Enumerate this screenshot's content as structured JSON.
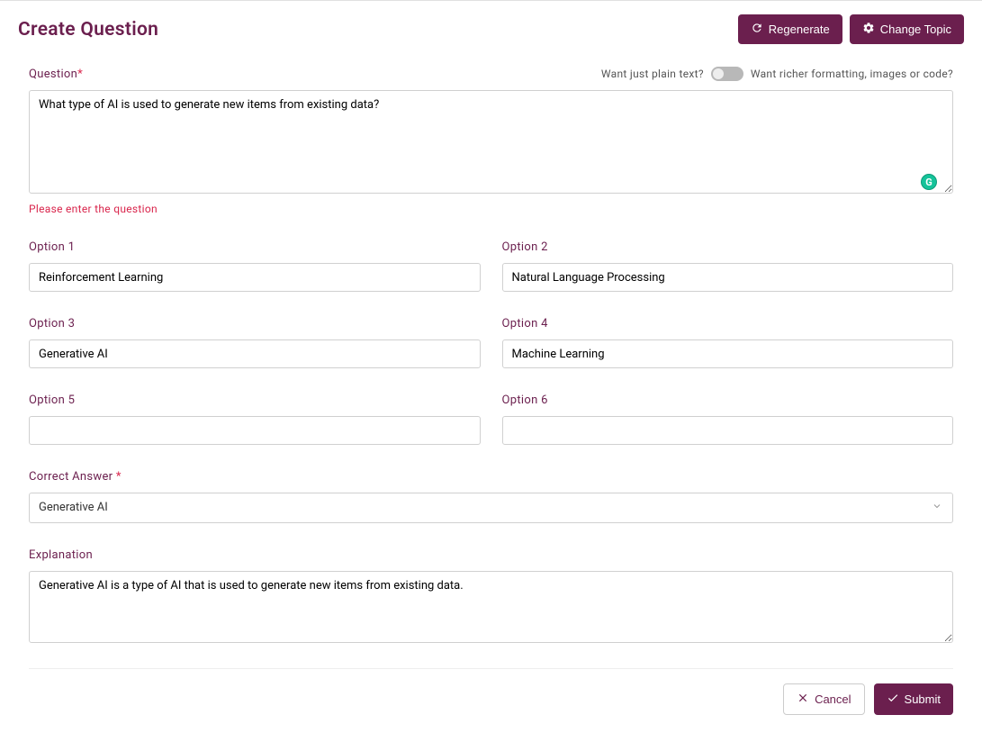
{
  "header": {
    "title": "Create Question",
    "regenerate": "Regenerate",
    "change_topic": "Change Topic"
  },
  "question": {
    "label": "Question",
    "toggle_left": "Want just plain text?",
    "toggle_right": "Want richer formatting, images or code?",
    "value": "What type of AI is used to generate new items from existing data?",
    "error": "Please enter the question"
  },
  "options": {
    "opt1": {
      "label": "Option 1",
      "value": "Reinforcement Learning"
    },
    "opt2": {
      "label": "Option 2",
      "value": "Natural Language Processing"
    },
    "opt3": {
      "label": "Option 3",
      "value": "Generative AI"
    },
    "opt4": {
      "label": "Option 4",
      "value": "Machine Learning"
    },
    "opt5": {
      "label": "Option 5",
      "value": ""
    },
    "opt6": {
      "label": "Option 6",
      "value": ""
    }
  },
  "correct": {
    "label": "Correct Answer ",
    "value": "Generative AI"
  },
  "explanation": {
    "label": "Explanation",
    "value": "Generative AI is a type of AI that is used to generate new items from existing data."
  },
  "footer": {
    "cancel": "Cancel",
    "submit": "Submit"
  },
  "grammarly": "G"
}
